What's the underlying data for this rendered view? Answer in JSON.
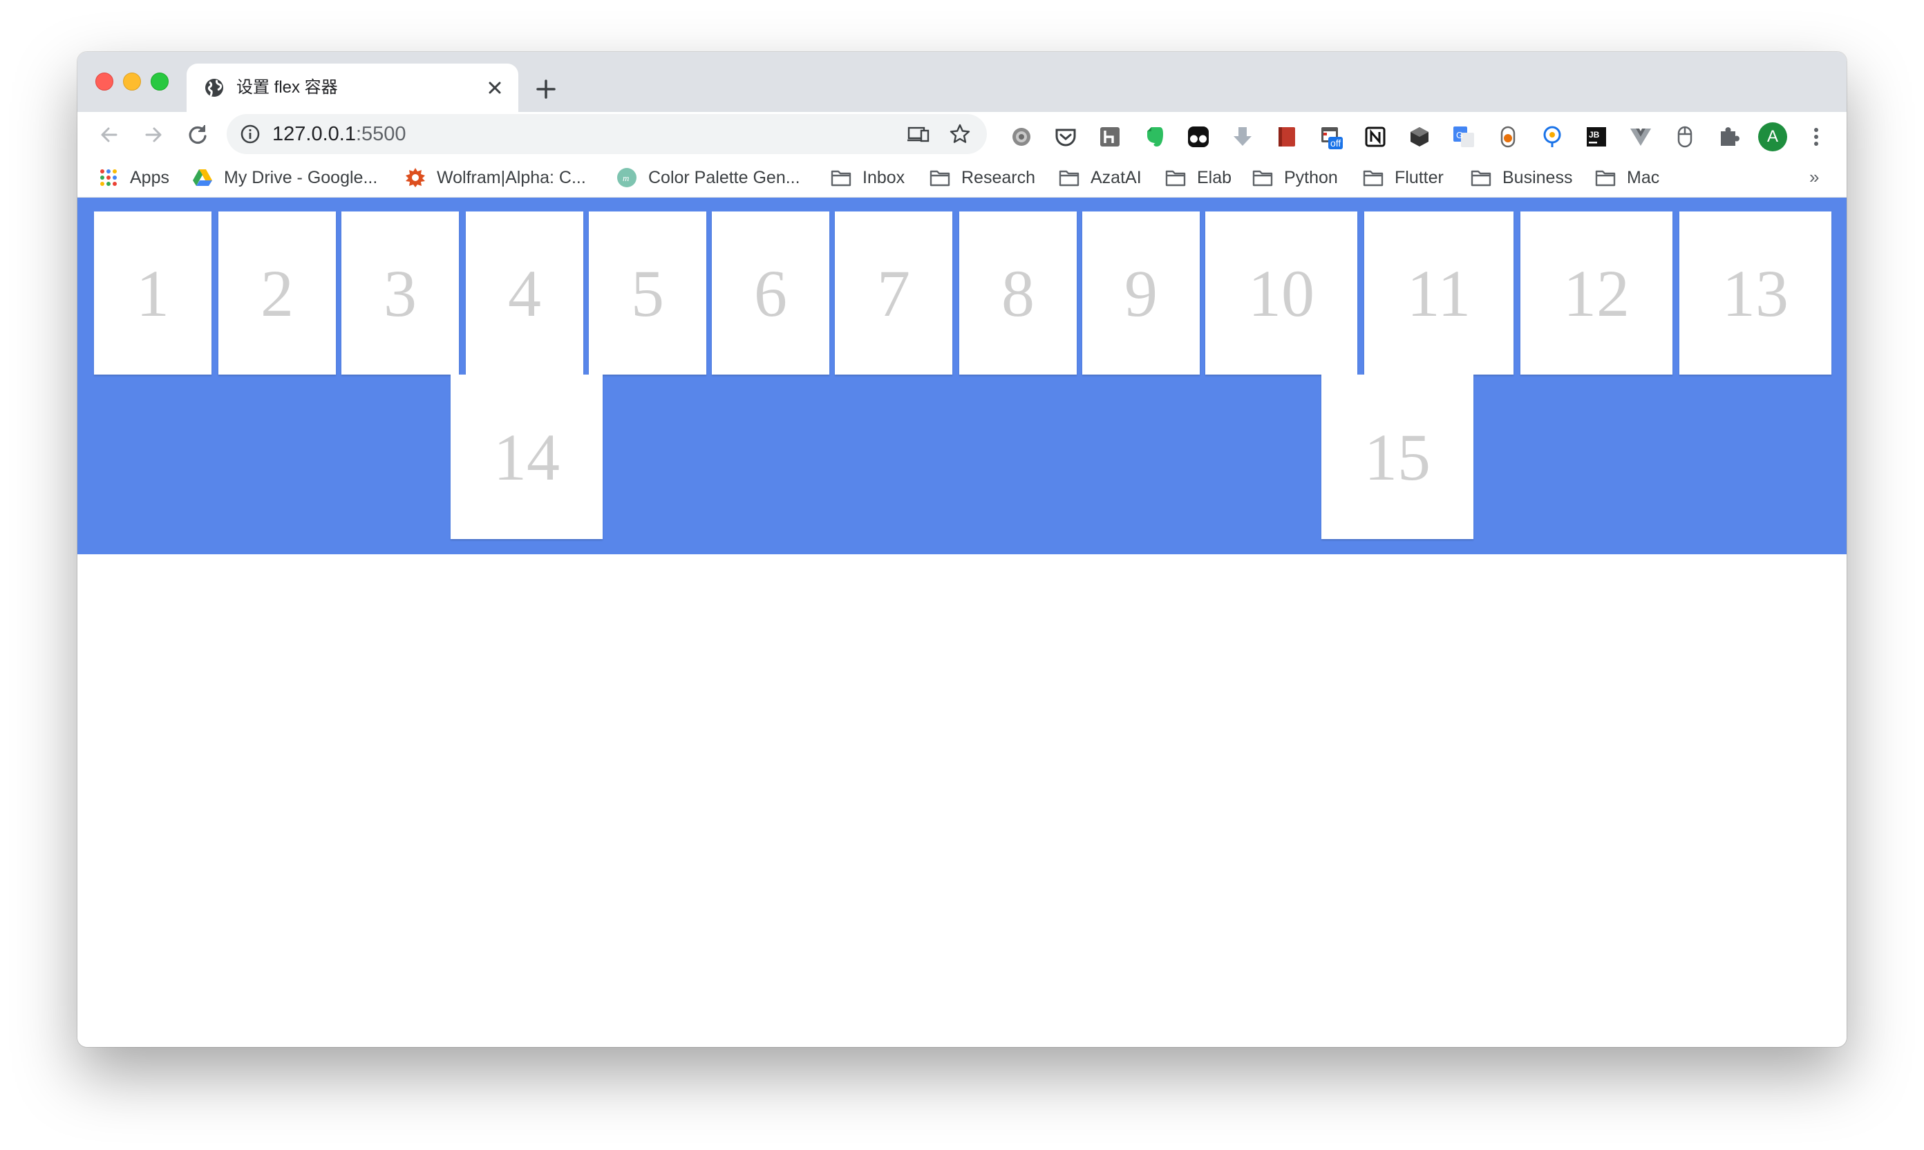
{
  "window": {
    "traffic_lights": {
      "close_color": "#ff5f57",
      "minimize_color": "#febc2e",
      "zoom_color": "#28c840"
    }
  },
  "tab": {
    "title": "设置 flex 容器",
    "icon": "globe-icon"
  },
  "toolbar": {
    "url_host": "127.0.0.1",
    "url_port": ":5500",
    "extensions": [
      "settings-gear-icon",
      "pocket-icon",
      "h-extension-icon",
      "evernote-icon",
      "tampermonkey-icon",
      "download-arrow-icon",
      "red-book-icon",
      "off-badge-extension-icon",
      "notion-icon",
      "cube-icon",
      "google-translate-icon",
      "tomato-timer-icon",
      "location-pin-icon",
      "jetbrains-icon",
      "vue-devtools-icon",
      "mouse-icon",
      "puzzle-icon"
    ],
    "extension_badge": "off",
    "profile_initial": "A",
    "profile_color": "#1e8e3e"
  },
  "bookmarks": {
    "items": [
      {
        "label": "Apps",
        "icon": "apps-grid-icon"
      },
      {
        "label": "My Drive - Google...",
        "icon": "google-drive-icon"
      },
      {
        "label": "Wolfram|Alpha: C...",
        "icon": "wolfram-icon"
      },
      {
        "label": "Color Palette Gen...",
        "icon": "color-palette-icon"
      },
      {
        "label": "Inbox",
        "icon": "folder-icon"
      },
      {
        "label": "Research",
        "icon": "folder-icon"
      },
      {
        "label": "AzatAI",
        "icon": "folder-icon"
      },
      {
        "label": "Elab",
        "icon": "folder-icon"
      },
      {
        "label": "Python",
        "icon": "folder-icon"
      },
      {
        "label": "Flutter",
        "icon": "folder-icon"
      },
      {
        "label": "Business",
        "icon": "folder-icon"
      },
      {
        "label": "Mac",
        "icon": "folder-icon"
      }
    ],
    "overflow": "»"
  },
  "page": {
    "container_color": "#5886ea",
    "box_text_color": "#cfcfcf",
    "boxes": [
      "1",
      "2",
      "3",
      "4",
      "5",
      "6",
      "7",
      "8",
      "9",
      "10",
      "11",
      "12",
      "13",
      "14",
      "15"
    ]
  }
}
